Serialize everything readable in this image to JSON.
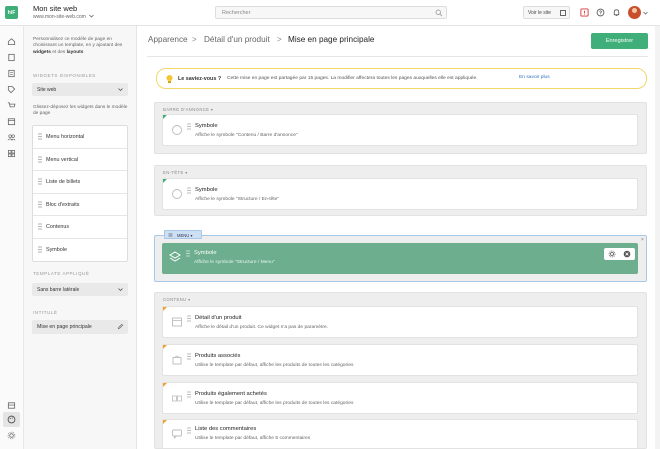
{
  "app": {
    "logo_text": "hiF",
    "site_title": "Mon site web",
    "site_url": "www.mon-site-web.com"
  },
  "header": {
    "search_placeholder": "Rechercher",
    "visit_label": "Voir le site"
  },
  "panel": {
    "intro_1": "Personnalisez ce modèle de page en choisissant un template, en y ajoutant des ",
    "intro_bold_1": "widgets",
    "intro_2": " et des ",
    "intro_bold_2": "layouts",
    "widgets_label": "Widgets disponibles",
    "widgets_source": "Site web",
    "drag_hint": "Glissez-déposez les widgets dans le modèle de page",
    "widgets": [
      "Menu horizontal",
      "Menu vertical",
      "Liste de billets",
      "Bloc d'extraits",
      "Contenus",
      "Symbole"
    ],
    "template_label": "Template appliqué",
    "template_value": "Sans barre latérale",
    "title_label": "Intitulé",
    "title_value": "Mise en page principale"
  },
  "breadcrumb": {
    "items": [
      "Apparence",
      "Détail d'un produit",
      "Mise en page principale"
    ],
    "separator": ">"
  },
  "toolbar": {
    "save_label": "Enregistrer"
  },
  "tip": {
    "title": "Le saviez-vous ?",
    "text": "Cette mise en page est partagée par 15 pages. La modifier affectera toutes les pages auxquelles elle est appliquée.",
    "link": "En savoir plus"
  },
  "zones": [
    {
      "label": "BARRE D'ANNONCE",
      "cards": [
        {
          "title": "Symbole",
          "desc": "Affiche le symbole \"Contenu / Barre d'annonce\""
        }
      ]
    },
    {
      "label": "EN-TÊTE",
      "cards": [
        {
          "title": "Symbole",
          "desc": "Affiche le symbole \"Structure / En-tête\""
        }
      ]
    },
    {
      "label": "MENU",
      "cards": [
        {
          "title": "Symbole",
          "desc": "Affiche le symbole \"Structure / Menu\""
        }
      ]
    },
    {
      "label": "CONTENU",
      "cards": [
        {
          "title": "Détail d'un produit",
          "desc": "Affiche le détail d'un produit. Ce widget n'a pas de paramètre."
        },
        {
          "title": "Produits associés",
          "desc": "Utilise le template par défaut, affiche les produits de toutes les catégories"
        },
        {
          "title": "Produits également achetés",
          "desc": "Utilise le template par défaut, affiche les produits de toutes les catégories"
        },
        {
          "title": "Liste des commentaires",
          "desc": "Utilise le template par défaut, affiche 5 commentaires"
        }
      ]
    }
  ],
  "colors": {
    "accent": "#3fae78",
    "selected": "#6cae8d",
    "corner_green": "#3fae78",
    "corner_orange": "#f0a030",
    "tip_border": "#f2d86b",
    "link": "#2f74c0"
  },
  "icons": {
    "search": "search-icon",
    "external": "external-link-icon",
    "notification": "bell-icon",
    "help": "help-icon",
    "alert": "alert-icon",
    "grip": "drag-handle-icon",
    "settings": "gear-icon",
    "remove": "remove-icon"
  }
}
